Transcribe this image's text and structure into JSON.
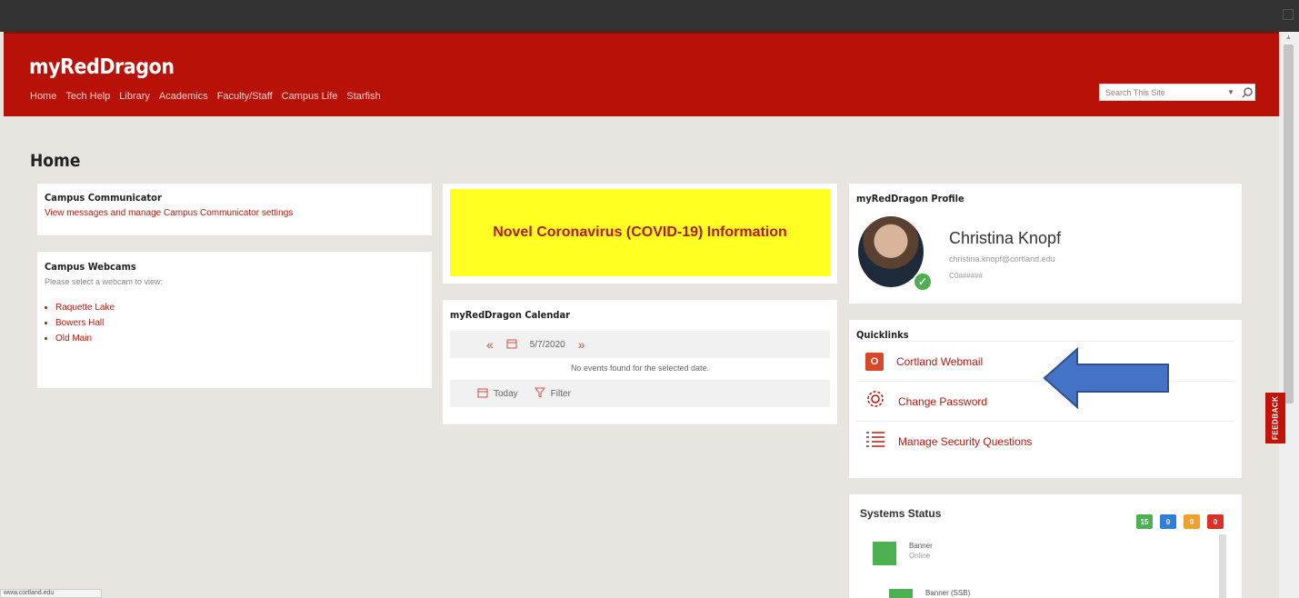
{
  "app": {
    "title": "myRedDragon"
  },
  "nav": [
    "Home",
    "Tech Help",
    "Library",
    "Academics",
    "Faculty/Staff",
    "Campus Life",
    "Starfish"
  ],
  "search": {
    "placeholder": "Search This Site"
  },
  "feedback": {
    "label": "FEEDBACK"
  },
  "page": {
    "title": "Home"
  },
  "campus_communicator": {
    "title": "Campus Communicator",
    "link": "View messages and manage Campus Communicator settings"
  },
  "campus_webcams": {
    "title": "Campus Webcams",
    "description": "Please select a webcam to view:",
    "items": [
      "Raquette Lake",
      "Bowers Hall",
      "Old Main"
    ]
  },
  "covid": {
    "label": "Novel Coronavirus (COVID-19) Information"
  },
  "calendar": {
    "title": "myRedDragon Calendar",
    "date": "5/7/2020",
    "empty": "No events found for the selected date.",
    "today_label": "Today",
    "filter_label": "Filter"
  },
  "profile": {
    "title": "myRedDragon Profile",
    "name": "Christina Knopf",
    "email": "christina.knopf@cortland.edu",
    "id": "C0######"
  },
  "quicklinks": {
    "title": "Quicklinks",
    "items": [
      {
        "label": "Cortland Webmail",
        "icon": "outlook-icon"
      },
      {
        "label": "Change Password",
        "icon": "gear-icon"
      },
      {
        "label": "Manage Security Questions",
        "icon": "list-icon"
      }
    ]
  },
  "systems_status": {
    "title": "Systems Status",
    "counts": [
      "15",
      "0",
      "0",
      "0"
    ],
    "count_colors": [
      "#4caf50",
      "#2f7ed8",
      "#f0a030",
      "#d9302a"
    ],
    "items": [
      {
        "name": "Banner",
        "state": "Online"
      },
      {
        "name": "Banner (SSB)",
        "state": ""
      }
    ]
  },
  "statusbar": {
    "text": "www.cortland.edu"
  },
  "colors": {
    "brand": "#b81208",
    "link": "#b11a10",
    "covid_bg": "#ffff22",
    "arrow": "#4472c4"
  }
}
